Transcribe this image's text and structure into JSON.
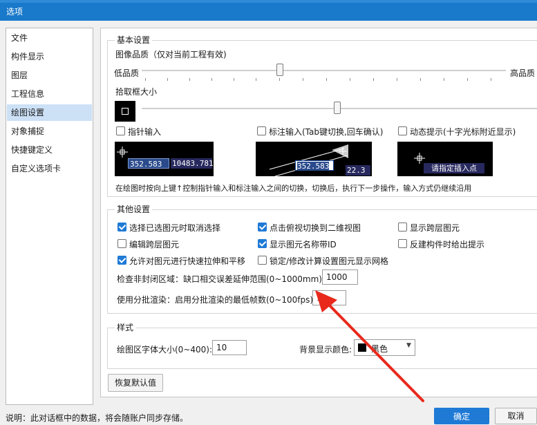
{
  "window": {
    "title": "选项"
  },
  "nav": {
    "items": [
      "文件",
      "构件显示",
      "图层",
      "工程信息",
      "绘图设置",
      "对象捕捉",
      "快捷键定义",
      "自定义选项卡"
    ],
    "selected_index": 4
  },
  "basic": {
    "group_title": "基本设置",
    "image_quality_label": "图像品质（仅对当前工程有效)",
    "quality_low": "低品质",
    "quality_high": "高品质",
    "quality_level": 0.42,
    "pick_box_label": "拾取框大小",
    "pick_box_level": 0.5,
    "pointer_input": {
      "label": "指针输入",
      "checked": false
    },
    "dimension_input": {
      "label": "标注输入(Tab键切换,回车确认)",
      "checked": false
    },
    "dynamic_prompt": {
      "label": "动态提示(十字光标附近显示)",
      "checked": false
    },
    "preview1": {
      "value1": "352.583",
      "value2": "10483.781"
    },
    "preview2": {
      "value1": "352.583",
      "value2": "22.3"
    },
    "preview3": {
      "text": "请指定插入点"
    },
    "description": "在绘图时按向上键↑控制指针输入和标注输入之间的切换，切换后，执行下一步操作，输入方式仍继续沿用"
  },
  "other": {
    "group_title": "其他设置",
    "checkboxes": [
      {
        "label": "选择已选图元时取消选择",
        "checked": true
      },
      {
        "label": "点击俯视切换到二维视图",
        "checked": true
      },
      {
        "label": "显示跨层图元",
        "checked": false
      },
      {
        "label": "编辑跨层图元",
        "checked": false
      },
      {
        "label": "显示图元名称带ID",
        "checked": true
      },
      {
        "label": "反建构件时给出提示",
        "checked": false
      },
      {
        "label": "允许对图元进行快速拉伸和平移",
        "checked": true
      },
      {
        "label": "锁定/修改计算设置图元显示网格",
        "checked": false
      }
    ],
    "gap_label": "检查非封闭区域：缺口相交误差延伸范围(0~1000mm):",
    "gap_value": "1000",
    "batch_label": "使用分批渲染：启用分批渲染的最低帧数(0~100fps):",
    "batch_value": "10"
  },
  "style": {
    "group_title": "样式",
    "font_size_label": "绘图区字体大小(0~400):",
    "font_size_value": "10",
    "bg_color_label": "背景显示颜色:",
    "bg_color_value": "黑色",
    "bg_color_hex": "#000000"
  },
  "buttons": {
    "restore_default": "恢复默认值",
    "ok": "确定",
    "cancel": "取消"
  },
  "footer": {
    "note": "说明：此对话框中的数据，将会随账户同步存储。"
  },
  "colors": {
    "title_bar": "#1979ca",
    "accent": "#1f7ad6",
    "selected_nav": "#cce0f6",
    "annotation_arrow": "#e8291c"
  }
}
